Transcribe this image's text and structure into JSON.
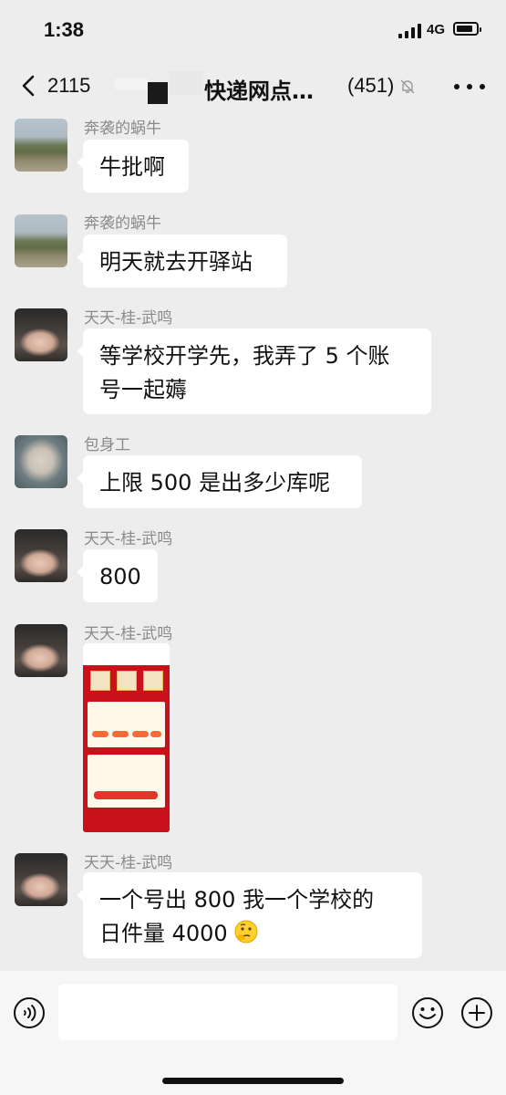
{
  "status_bar": {
    "time": "1:38",
    "network": "4G"
  },
  "nav": {
    "back_count": "2115",
    "title": "快递网点…",
    "member_count": "(451)"
  },
  "messages": [
    {
      "sender": "奔袭的蜗牛",
      "avatar": "landscape-avatar",
      "lines": [
        "牛批啊"
      ]
    },
    {
      "sender": "奔袭的蜗牛",
      "avatar": "landscape-avatar",
      "lines": [
        "明天就去开驿站"
      ]
    },
    {
      "sender": "天天-桂-武鸣",
      "avatar": "cat-avatar",
      "lines": [
        "等学校开学先，我弄了 5 个账",
        "号一起薅"
      ]
    },
    {
      "sender": "包身工",
      "avatar": "kratos-avatar",
      "lines": [
        "上限 500 是出多少库呢"
      ]
    },
    {
      "sender": "天天-桂-武鸣",
      "avatar": "cat-avatar",
      "lines": [
        "800"
      ]
    },
    {
      "sender": "天天-桂-武鸣",
      "avatar": "cat-avatar",
      "image": "app-screenshot-thumbnail"
    },
    {
      "sender": "天天-桂-武鸣",
      "avatar": "cat-avatar",
      "lines": [
        "一个号出 800  我一个学校的",
        "日件量  4000"
      ],
      "emoji": "thinking-face-emoji"
    }
  ],
  "input_bar": {
    "value": "",
    "placeholder": ""
  },
  "icons": {
    "back": "chevron-left-icon",
    "mute": "bell-slash-icon",
    "more": "more-dots-icon",
    "voice": "voice-icon",
    "emoji": "smiley-icon",
    "plus": "plus-icon"
  },
  "colors": {
    "chat_background": "#ededed",
    "bubble": "#ffffff",
    "screenshot_red": "#c9111b"
  }
}
